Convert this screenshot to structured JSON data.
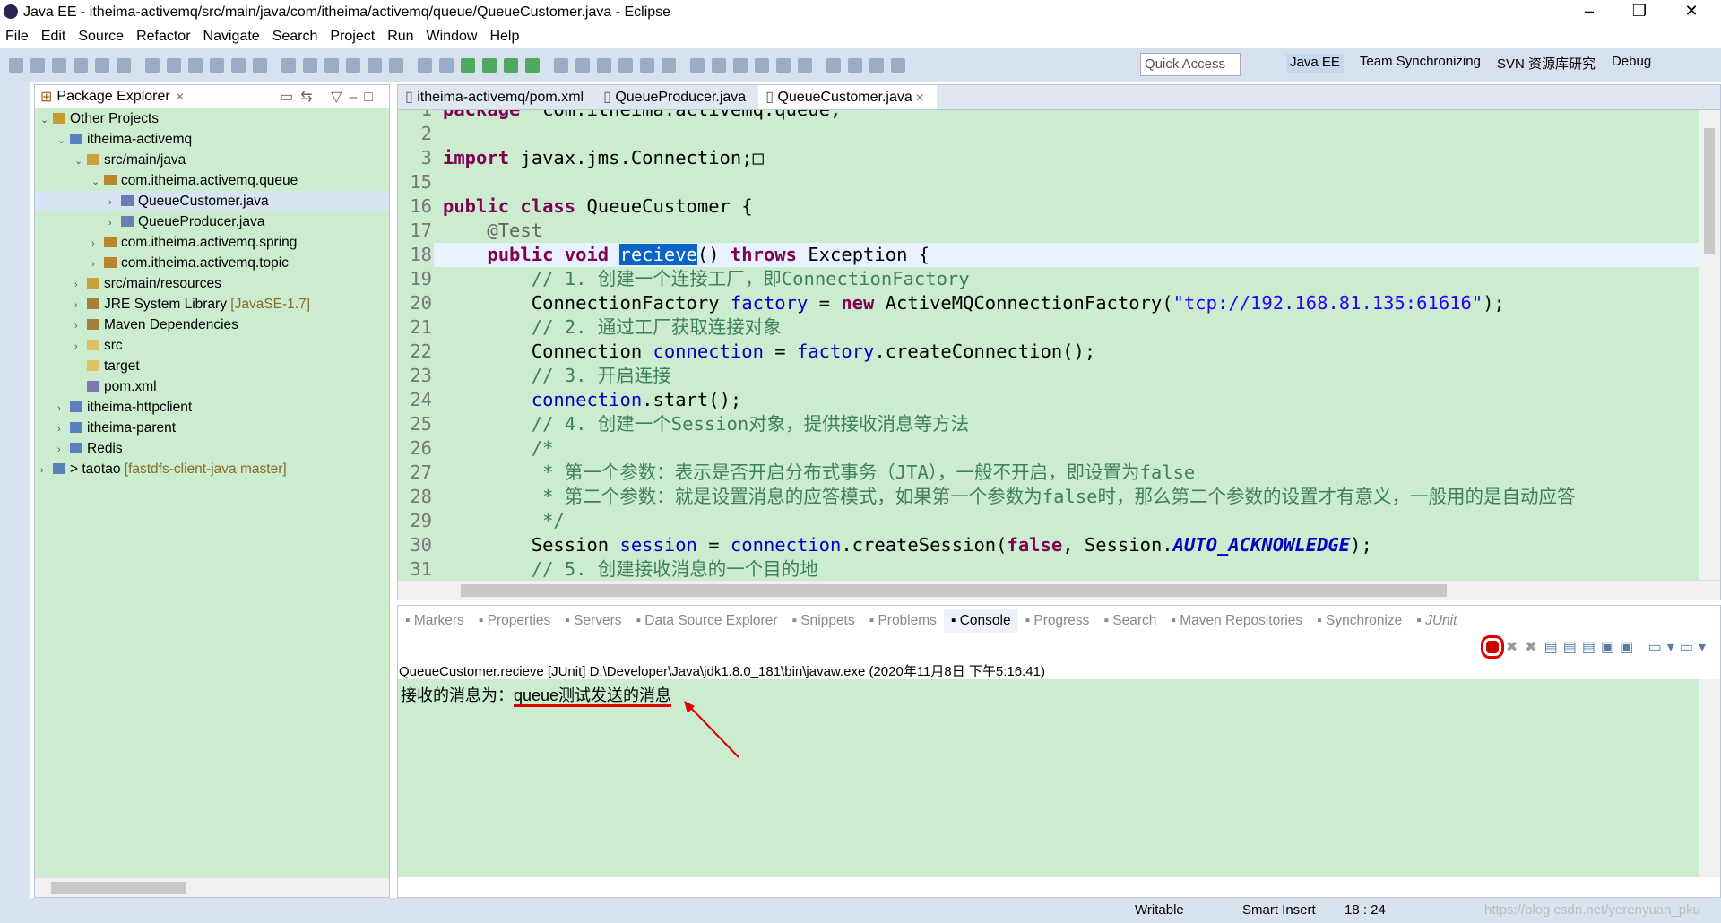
{
  "window": {
    "title": "Java EE - itheima-activemq/src/main/java/com/itheima/activemq/queue/QueueCustomer.java - Eclipse"
  },
  "menu": [
    "File",
    "Edit",
    "Source",
    "Refactor",
    "Navigate",
    "Search",
    "Project",
    "Run",
    "Window",
    "Help"
  ],
  "toolbar": {
    "quick_access": "Quick Access",
    "perspectives": [
      "Java EE",
      "Team Synchronizing",
      "SVN 资源库研究",
      "Debug"
    ]
  },
  "package_explorer": {
    "title": "Package Explorer",
    "items": [
      {
        "level": 0,
        "arrow": "v",
        "label": "Other Projects",
        "icon": "working-set"
      },
      {
        "level": 1,
        "arrow": "v",
        "label": "itheima-activemq",
        "icon": "project"
      },
      {
        "level": 2,
        "arrow": "v",
        "label": "src/main/java",
        "icon": "source-folder"
      },
      {
        "level": 3,
        "arrow": "v",
        "label": "com.itheima.activemq.queue",
        "icon": "package"
      },
      {
        "level": 4,
        "arrow": ">",
        "label": "QueueCustomer.java",
        "icon": "java-file",
        "selected": true
      },
      {
        "level": 4,
        "arrow": ">",
        "label": "QueueProducer.java",
        "icon": "java-file"
      },
      {
        "level": 3,
        "arrow": ">",
        "label": "com.itheima.activemq.spring",
        "icon": "package"
      },
      {
        "level": 3,
        "arrow": ">",
        "label": "com.itheima.activemq.topic",
        "icon": "package"
      },
      {
        "level": 2,
        "arrow": ">",
        "label": "src/main/resources",
        "icon": "source-folder"
      },
      {
        "level": 2,
        "arrow": ">",
        "label": "JRE System Library",
        "decoration": "[JavaSE-1.7]",
        "icon": "library"
      },
      {
        "level": 2,
        "arrow": ">",
        "label": "Maven Dependencies",
        "icon": "library"
      },
      {
        "level": 2,
        "arrow": ">",
        "label": "src",
        "icon": "folder"
      },
      {
        "level": 2,
        "arrow": "",
        "label": "target",
        "icon": "folder"
      },
      {
        "level": 2,
        "arrow": "",
        "label": "pom.xml",
        "icon": "xml-file"
      },
      {
        "level": 1,
        "arrow": ">",
        "label": "itheima-httpclient",
        "icon": "project"
      },
      {
        "level": 1,
        "arrow": ">",
        "label": "itheima-parent",
        "icon": "project"
      },
      {
        "level": 1,
        "arrow": ">",
        "label": "Redis",
        "icon": "project"
      },
      {
        "level": 0,
        "arrow": ">",
        "label": "> taotao",
        "decoration": "[fastdfs-client-java master]",
        "icon": "project"
      }
    ]
  },
  "editor": {
    "tabs": [
      {
        "label": "itheima-activemq/pom.xml"
      },
      {
        "label": "QueueProducer.java"
      },
      {
        "label": "QueueCustomer.java",
        "active": true
      }
    ],
    "lines": [
      {
        "n": "1",
        "t": [
          [
            "kw",
            "package"
          ],
          [
            "",
            "  com.itheima.activemq.queue;"
          ]
        ]
      },
      {
        "n": "2",
        "t": []
      },
      {
        "n": "3",
        "t": [
          [
            "kw",
            "import"
          ],
          [
            "",
            " javax.jms.Connection;□"
          ]
        ]
      },
      {
        "n": "15",
        "t": []
      },
      {
        "n": "16",
        "t": [
          [
            "kw",
            "public class"
          ],
          [
            "",
            " QueueCustomer {"
          ]
        ]
      },
      {
        "n": "17",
        "t": [
          [
            "an",
            "    @Test"
          ]
        ]
      },
      {
        "n": "18",
        "cur": true,
        "t": [
          [
            "",
            "    "
          ],
          [
            "kw",
            "public void"
          ],
          [
            "",
            " "
          ],
          [
            "hl",
            "recieve"
          ],
          [
            "",
            "() "
          ],
          [
            "kw",
            "throws"
          ],
          [
            "",
            " Exception {"
          ]
        ]
      },
      {
        "n": "19",
        "t": [
          [
            "cm",
            "        // 1. 创建一个连接工厂，即ConnectionFactory"
          ]
        ]
      },
      {
        "n": "20",
        "t": [
          [
            "",
            "        ConnectionFactory "
          ],
          [
            "fld",
            "factory"
          ],
          [
            "",
            " = "
          ],
          [
            "kw",
            "new"
          ],
          [
            "",
            " ActiveMQConnectionFactory("
          ],
          [
            "str",
            "\"tcp://192.168.81.135:61616\""
          ],
          [
            "",
            ");"
          ]
        ]
      },
      {
        "n": "21",
        "t": [
          [
            "cm",
            "        // 2. 通过工厂获取连接对象"
          ]
        ]
      },
      {
        "n": "22",
        "t": [
          [
            "",
            "        Connection "
          ],
          [
            "fld",
            "connection"
          ],
          [
            "",
            " = "
          ],
          [
            "fld",
            "factory"
          ],
          [
            "",
            ".createConnection();"
          ]
        ]
      },
      {
        "n": "23",
        "t": [
          [
            "cm",
            "        // 3. 开启连接"
          ]
        ]
      },
      {
        "n": "24",
        "t": [
          [
            "fld",
            "        connection"
          ],
          [
            "",
            ".start();"
          ]
        ]
      },
      {
        "n": "25",
        "t": [
          [
            "cm",
            "        // 4. 创建一个Session对象，提供接收消息等方法"
          ]
        ]
      },
      {
        "n": "26",
        "t": [
          [
            "cm",
            "        /*"
          ]
        ]
      },
      {
        "n": "27",
        "t": [
          [
            "cm",
            "         * 第一个参数：表示是否开启分布式事务（JTA），一般不开启，即设置为false"
          ]
        ]
      },
      {
        "n": "28",
        "t": [
          [
            "cm",
            "         * 第二个参数：就是设置消息的应答模式，如果第一个参数为false时，那么第二个参数的设置才有意义，一般用的是自动应答"
          ]
        ]
      },
      {
        "n": "29",
        "t": [
          [
            "cm",
            "         */"
          ]
        ]
      },
      {
        "n": "30",
        "t": [
          [
            "",
            "        Session "
          ],
          [
            "fld",
            "session"
          ],
          [
            "",
            " = "
          ],
          [
            "fld",
            "connection"
          ],
          [
            "",
            ".createSession("
          ],
          [
            "kw",
            "false"
          ],
          [
            "",
            ", Session."
          ],
          [
            "cst",
            "AUTO_ACKNOWLEDGE"
          ],
          [
            "",
            ");"
          ]
        ]
      },
      {
        "n": "31",
        "t": [
          [
            "cm",
            "        // 5. 创建接收消息的一个目的地"
          ]
        ]
      }
    ]
  },
  "bottom": {
    "tabs": [
      {
        "label": "Markers"
      },
      {
        "label": "Properties"
      },
      {
        "label": "Servers"
      },
      {
        "label": "Data Source Explorer"
      },
      {
        "label": "Snippets"
      },
      {
        "label": "Problems"
      },
      {
        "label": "Console",
        "active": true
      },
      {
        "label": "Progress"
      },
      {
        "label": "Search"
      },
      {
        "label": "Maven Repositories"
      },
      {
        "label": "Synchronize"
      },
      {
        "label": "JUnit"
      }
    ],
    "launch": "QueueCustomer.recieve [JUnit] D:\\Developer\\Java\\jdk1.8.0_181\\bin\\javaw.exe (2020年11月8日 下午5:16:41)",
    "output_prefix": "接收的消息为：",
    "output_message": "queue测试发送的消息"
  },
  "status": {
    "mode": "Writable",
    "insert": "Smart Insert",
    "position": "18 : 24",
    "watermark": "https://blog.csdn.net/yerenyuan_pku"
  },
  "colors": {
    "editor_bg": "#cbeccf",
    "annotation": "#e00000",
    "selection": "#0a64c8"
  }
}
